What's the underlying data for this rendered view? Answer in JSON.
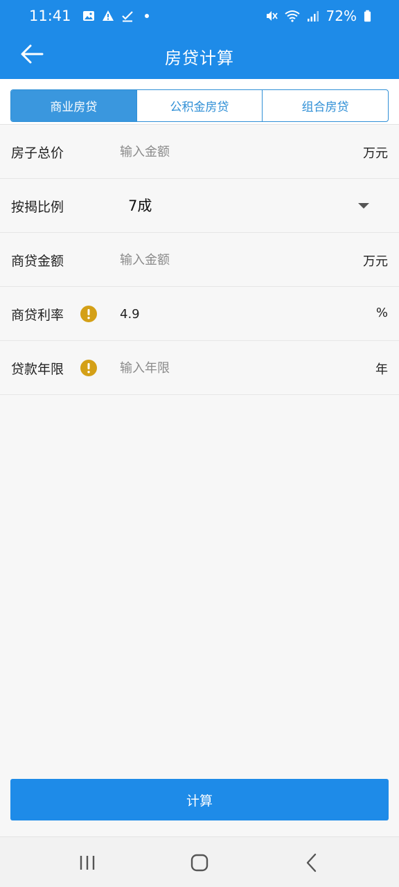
{
  "status_bar": {
    "time": "11:41",
    "battery": "72%"
  },
  "app_bar": {
    "title": "房贷计算"
  },
  "tabs": [
    {
      "label": "商业房贷",
      "active": true
    },
    {
      "label": "公积金房贷",
      "active": false
    },
    {
      "label": "组合房贷",
      "active": false
    }
  ],
  "form": {
    "total_price": {
      "label": "房子总价",
      "placeholder": "输入金额",
      "value": "",
      "unit": "万元"
    },
    "down_ratio": {
      "label": "按揭比例",
      "selected": "7成"
    },
    "loan_amount": {
      "label": "商贷金额",
      "placeholder": "输入金额",
      "value": "",
      "unit": "万元"
    },
    "interest_rate": {
      "label": "商贷利率",
      "placeholder": "",
      "value": "4.9",
      "unit": "%"
    },
    "loan_years": {
      "label": "贷款年限",
      "placeholder": "输入年限",
      "value": "",
      "unit": "年"
    }
  },
  "calculate_label": "计算",
  "colors": {
    "primary": "#1e8be8",
    "tab_border": "#2f8fd6",
    "warning": "#d4a017"
  }
}
